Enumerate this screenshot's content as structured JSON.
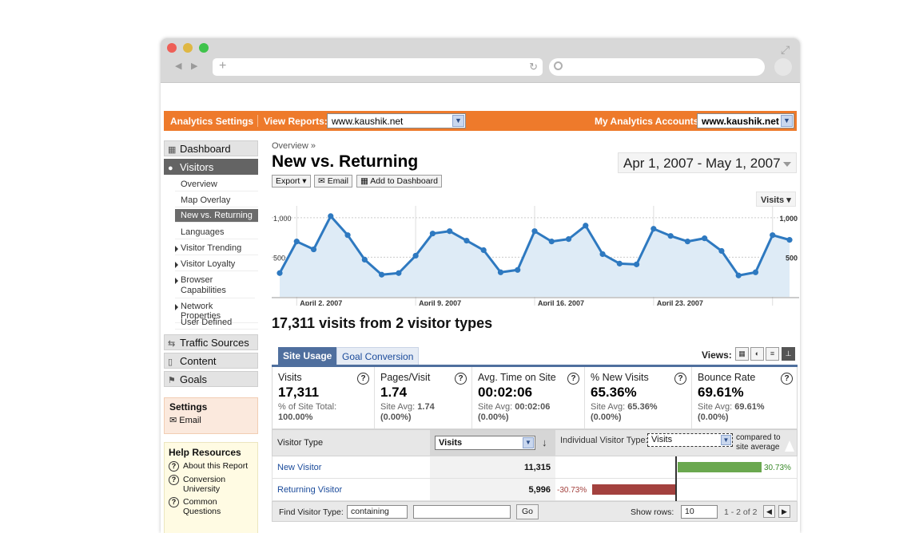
{
  "browser": {
    "back": "◀",
    "forward": "▶",
    "new_tab": "+",
    "reload": "↻"
  },
  "topbar": {
    "analytics_settings": "Analytics Settings",
    "view_reports_label": "View Reports:",
    "view_reports_value": "www.kaushik.net",
    "accounts_label": "My Analytics Accounts:",
    "accounts_value": "www.kaushik.net"
  },
  "nav": {
    "dashboard": "Dashboard",
    "visitors": "Visitors",
    "sub": [
      "Overview",
      "Map Overlay",
      "New vs. Returning",
      "Languages",
      "Visitor Trending",
      "Visitor Loyalty",
      "Browser Capabilities",
      "Network Properties",
      "User Defined"
    ],
    "traffic_sources": "Traffic Sources",
    "content": "Content",
    "goals": "Goals"
  },
  "settings": {
    "title": "Settings",
    "email": "Email"
  },
  "help": {
    "title": "Help Resources",
    "items": [
      "About this Report",
      "Conversion University",
      "Common Questions"
    ]
  },
  "page": {
    "breadcrumb": "Overview »",
    "title": "New vs. Returning",
    "date_range": "Apr 1, 2007 - May 1, 2007",
    "export": "Export ▾",
    "email": "Email",
    "add_dashboard": "Add to Dashboard",
    "visits_menu": "Visits ▾",
    "summary": "17,311 visits from 2 visitor types"
  },
  "chart_data": {
    "type": "line",
    "series": [
      {
        "name": "Visits",
        "values": [
          300,
          700,
          600,
          1020,
          780,
          470,
          280,
          300,
          520,
          800,
          830,
          710,
          590,
          310,
          340,
          830,
          700,
          730,
          900,
          540,
          420,
          410,
          860,
          770,
          700,
          740,
          580,
          270,
          310,
          780,
          720
        ]
      }
    ],
    "y_ticks_left": [
      "1,000",
      "500"
    ],
    "y_ticks_right": [
      "1,000",
      "500"
    ],
    "x_labels": [
      "April 2, 2007",
      "April 9, 2007",
      "April 16, 2007",
      "April 23, 2007"
    ],
    "ylim": [
      0,
      1150
    ],
    "colors": {
      "line": "#2e79c0",
      "fill": "#deebf6"
    }
  },
  "tabs": {
    "site_usage": "Site Usage",
    "goal_conversion": "Goal Conversion",
    "views": "Views:"
  },
  "metrics": [
    {
      "name": "Visits",
      "value": "17,311",
      "sub1": "% of Site Total:",
      "sub2": "100.00%"
    },
    {
      "name": "Pages/Visit",
      "value": "1.74",
      "sub1": "Site Avg: ",
      "sub1b": "1.74",
      "sub2": "(0.00%)"
    },
    {
      "name": "Avg. Time on Site",
      "value": "00:02:06",
      "sub1": "Site Avg: ",
      "sub1b": "00:02:06",
      "sub2": "(0.00%)"
    },
    {
      "name": "% New Visits",
      "value": "65.36%",
      "sub1": "Site Avg: ",
      "sub1b": "65.36%",
      "sub2": "(0.00%)"
    },
    {
      "name": "Bounce Rate",
      "value": "69.61%",
      "sub1": "Site Avg: ",
      "sub1b": "69.61%",
      "sub2": "(0.00%)"
    }
  ],
  "table": {
    "col_visitor_type": "Visitor Type",
    "sort_select": "Visits",
    "individual_label": "Individual Visitor Type:",
    "individual_select": "Visits",
    "compared": "compared to site average",
    "rows": [
      {
        "name": "New Visitor",
        "visits": "11,315",
        "pct": "30.73%",
        "pct_value": 30.73
      },
      {
        "name": "Returning Visitor",
        "visits": "5,996",
        "pct": "-30.73%",
        "pct_value": -30.73
      }
    ],
    "footer": {
      "find_label": "Find Visitor Type:",
      "find_select": "containing",
      "go": "Go",
      "show_rows": "Show rows:",
      "rows_value": "10",
      "range": "1 - 2 of 2"
    }
  }
}
